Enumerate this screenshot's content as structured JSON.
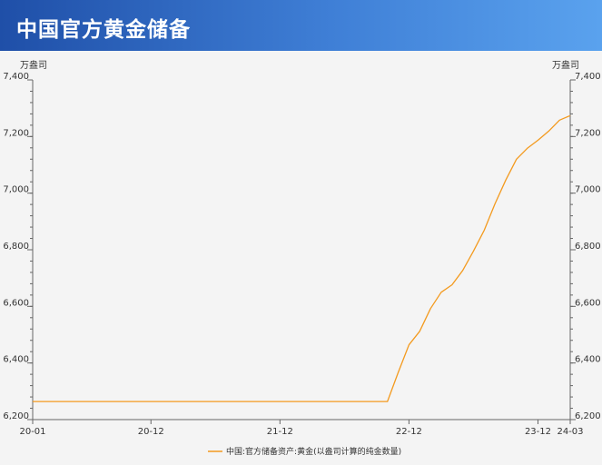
{
  "header": {
    "title": "中国官方黄金储备"
  },
  "colors": {
    "line": "#f39a1e",
    "axis": "#666666"
  },
  "chart_data": {
    "type": "line",
    "title": "",
    "xlabel": "",
    "ylabel": "",
    "y_unit_left": "万盎司",
    "y_unit_right": "万盎司",
    "ylim": [
      6200,
      7400
    ],
    "y_ticks": [
      6200,
      6400,
      6600,
      6800,
      7000,
      7200,
      7400
    ],
    "y_tick_labels": [
      "6,200",
      "6,400",
      "6,600",
      "6,800",
      "7,000",
      "7,200",
      "7,400"
    ],
    "x_tick_labels": [
      {
        "x": "2020-01",
        "label": "20-01"
      },
      {
        "x": "2020-12",
        "label": "20-12"
      },
      {
        "x": "2021-12",
        "label": "21-12"
      },
      {
        "x": "2022-12",
        "label": "22-12"
      },
      {
        "x": "2023-12",
        "label": "23-12"
      },
      {
        "x": "2024-03",
        "label": "24-03"
      }
    ],
    "legend": {
      "position": "bottom-center"
    },
    "grid": false,
    "series": [
      {
        "name": "中国:官方储备资产:黄金(以盎司计算的纯金数量)",
        "points": [
          {
            "x": "2020-01",
            "y": 6264
          },
          {
            "x": "2022-10",
            "y": 6264
          },
          {
            "x": "2022-11",
            "y": 6367
          },
          {
            "x": "2022-12",
            "y": 6464
          },
          {
            "x": "2023-01",
            "y": 6512
          },
          {
            "x": "2023-02",
            "y": 6592
          },
          {
            "x": "2023-03",
            "y": 6650
          },
          {
            "x": "2023-04",
            "y": 6676
          },
          {
            "x": "2023-05",
            "y": 6727
          },
          {
            "x": "2023-06",
            "y": 6795
          },
          {
            "x": "2023-07",
            "y": 6869
          },
          {
            "x": "2023-08",
            "y": 6962
          },
          {
            "x": "2023-09",
            "y": 7046
          },
          {
            "x": "2023-10",
            "y": 7120
          },
          {
            "x": "2023-11",
            "y": 7158
          },
          {
            "x": "2023-12",
            "y": 7187
          },
          {
            "x": "2024-01",
            "y": 7219
          },
          {
            "x": "2024-02",
            "y": 7258
          },
          {
            "x": "2024-03",
            "y": 7274
          }
        ]
      }
    ]
  }
}
